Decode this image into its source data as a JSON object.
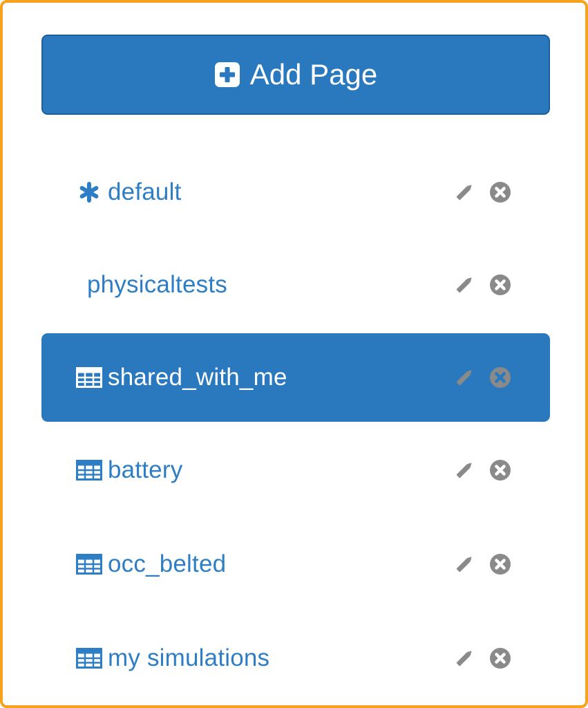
{
  "add_button": {
    "label": "Add Page",
    "icon": "plus-square-icon"
  },
  "pages": [
    {
      "label": "default",
      "icon": "asterisk-icon",
      "active": false
    },
    {
      "label": "physicaltests",
      "icon": "",
      "active": false
    },
    {
      "label": "shared_with_me",
      "icon": "table-icon",
      "active": true
    },
    {
      "label": "battery",
      "icon": "table-icon",
      "active": false
    },
    {
      "label": "occ_belted",
      "icon": "table-icon",
      "active": false
    },
    {
      "label": "my simulations",
      "icon": "table-icon",
      "active": false
    }
  ],
  "colors": {
    "primary": "#2a79bf",
    "primary_border": "#1f5f99",
    "link": "#2e7ec5",
    "action_icon": "#8a8a8a",
    "frame_border": "#f5a31a"
  }
}
